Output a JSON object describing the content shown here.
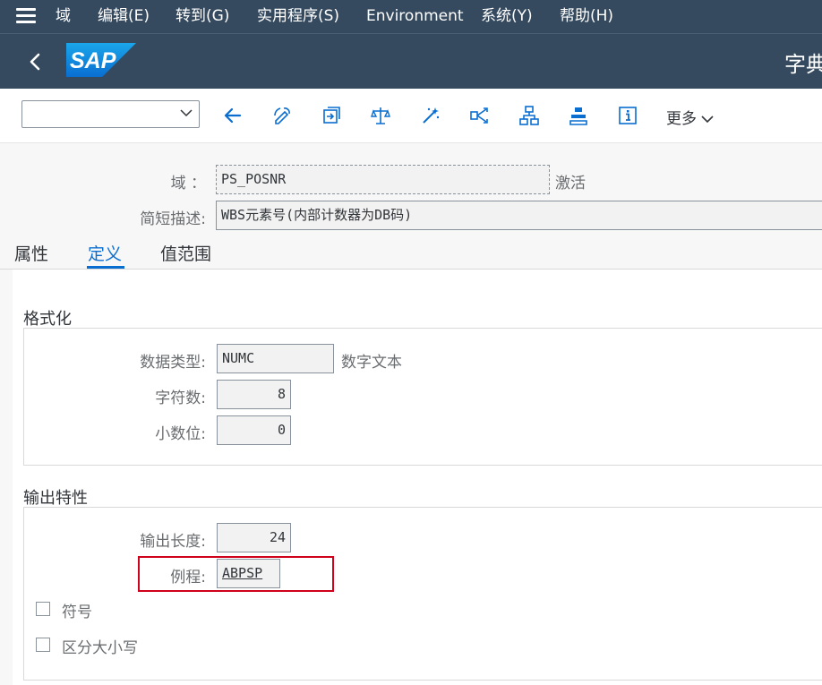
{
  "menubar": {
    "items": [
      "域",
      "编辑(E)",
      "转到(G)",
      "实用程序(S)",
      "Environment",
      "系统(Y)",
      "帮助(H)"
    ]
  },
  "shellbar": {
    "logo_text": "SAP",
    "title": "字典"
  },
  "toolbar": {
    "command_value": "",
    "icons": [
      "back-arrow-icon",
      "edit-toggle-icon",
      "where-used-icon",
      "check-icon",
      "activate-icon",
      "navigate-icon",
      "hierarchy-icon",
      "transport-icon",
      "info-icon"
    ],
    "more_label": "更多"
  },
  "header": {
    "domain_label": "域 ：",
    "domain_value": "PS_POSNR",
    "domain_status": "激活",
    "short_desc_label": "简短描述:",
    "short_desc_value": "WBS元素号(内部计数器为DB码)"
  },
  "tabs": [
    {
      "label": "属性",
      "active": false
    },
    {
      "label": "定义",
      "active": true
    },
    {
      "label": "值范围",
      "active": false
    }
  ],
  "format_group": {
    "title": "格式化",
    "data_type_label": "数据类型:",
    "data_type_value": "NUMC",
    "data_type_desc": "数字文本",
    "chars_label": "字符数:",
    "chars_value": "8",
    "decimals_label": "小数位:",
    "decimals_value": "0"
  },
  "output_group": {
    "title": "输出特性",
    "out_len_label": "输出长度:",
    "out_len_value": "24",
    "routine_label": "例程:",
    "routine_value": "ABPSP",
    "sign_label": "符号",
    "sign_checked": false,
    "lowercase_label": "区分大小写",
    "lowercase_checked": false
  },
  "colors": {
    "shell": "#354a5f",
    "accent": "#0a6ed1",
    "highlight": "#d0021b"
  }
}
